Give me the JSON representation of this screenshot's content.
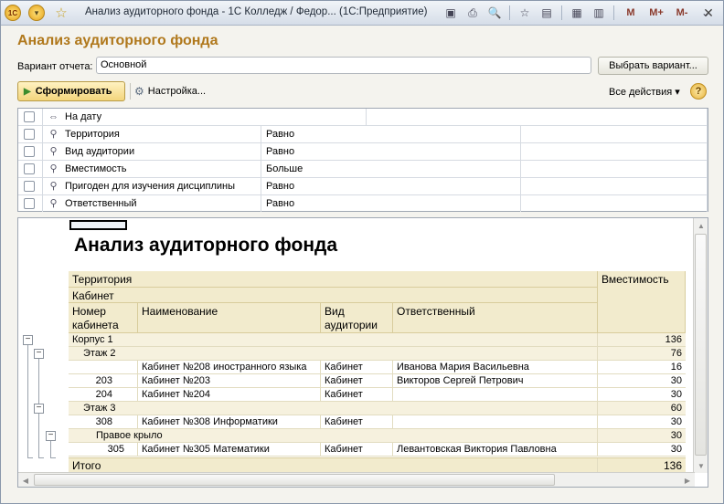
{
  "window": {
    "title": "Анализ аудиторного фонда - 1С Колледж / Федор...  (1С:Предприятие)",
    "logo_text": "1С",
    "toolbar_labels": {
      "m": "M",
      "m_plus": "M+",
      "m_minus": "M-"
    }
  },
  "form": {
    "title": "Анализ аудиторного фонда",
    "variant_label": "Вариант отчета:",
    "variant_value": "Основной",
    "choose_variant_label": "Выбрать вариант...",
    "run_label": "Сформировать",
    "settings_label": "Настройка...",
    "all_actions_label": "Все действия",
    "help_label": "?"
  },
  "filters": [
    {
      "name": "На дату",
      "condition": "",
      "value": ""
    },
    {
      "name": "Территория",
      "condition": "Равно",
      "value": ""
    },
    {
      "name": "Вид аудитории",
      "condition": "Равно",
      "value": ""
    },
    {
      "name": "Вместимость",
      "condition": "Больше",
      "value": ""
    },
    {
      "name": "Пригоден для изучения дисциплины",
      "condition": "Равно",
      "value": ""
    },
    {
      "name": "Ответственный",
      "condition": "Равно",
      "value": ""
    }
  ],
  "report": {
    "title": "Анализ аудиторного фонда",
    "headers": {
      "territory": "Территория",
      "cabinet": "Кабинет",
      "room_number": "Номер кабинета",
      "name": "Наименование",
      "room_type": "Вид аудитории",
      "responsible": "Ответственный",
      "capacity": "Вместимость"
    },
    "rows": [
      {
        "level": 0,
        "number": "Корпус 1",
        "name": "",
        "type": "",
        "responsible": "",
        "capacity": "136"
      },
      {
        "level": 1,
        "number": "Этаж 2",
        "name": "",
        "type": "",
        "responsible": "",
        "capacity": "76"
      },
      {
        "level": 2,
        "number": "",
        "name": "Кабинет №208 иностранного языка",
        "type": "Кабинет",
        "responsible": "Иванова Мария Васильевна",
        "capacity": "16"
      },
      {
        "level": 2,
        "number": "203",
        "name": "Кабинет №203",
        "type": "Кабинет",
        "responsible": "Викторов Сергей Петрович",
        "capacity": "30"
      },
      {
        "level": 2,
        "number": "204",
        "name": "Кабинет №204",
        "type": "Кабинет",
        "responsible": "",
        "capacity": "30"
      },
      {
        "level": 1,
        "number": "Этаж 3",
        "name": "",
        "type": "",
        "responsible": "",
        "capacity": "60"
      },
      {
        "level": 2,
        "number": "308",
        "name": "Кабинет №308 Информатики",
        "type": "Кабинет",
        "responsible": "",
        "capacity": "30"
      },
      {
        "level": 2,
        "number": "Правое крыло",
        "name": "",
        "type": "",
        "responsible": "",
        "capacity": "30"
      },
      {
        "level": 3,
        "number": "305",
        "name": "Кабинет №305 Математики",
        "type": "Кабинет",
        "responsible": "Левантовская Виктория Павловна",
        "capacity": "30"
      }
    ],
    "total_label": "Итого",
    "total_value": "136"
  }
}
